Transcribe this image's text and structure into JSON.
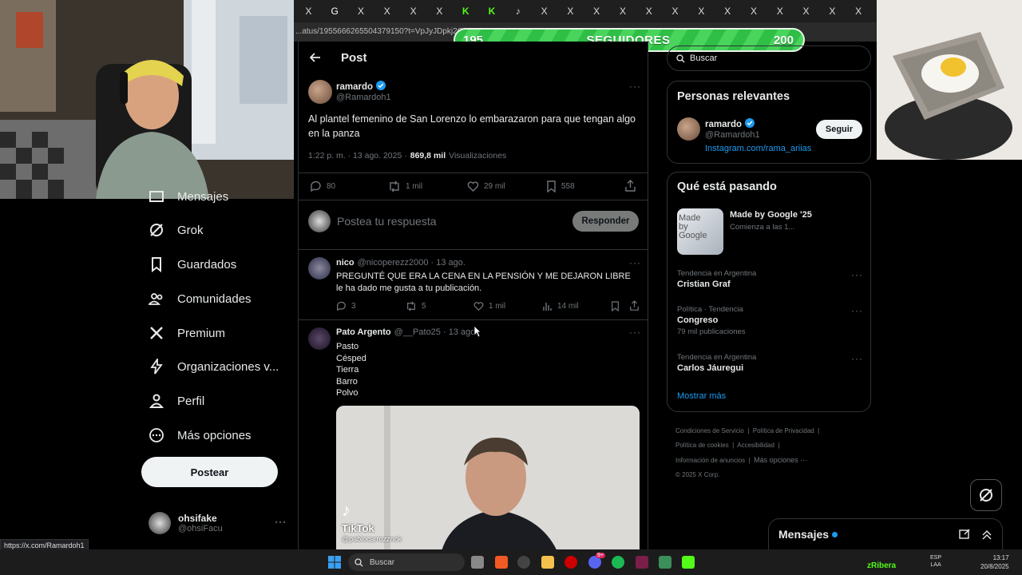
{
  "browser": {
    "tabs": [
      "X",
      "G",
      "X",
      "X",
      "X",
      "X",
      "K",
      "K",
      "♪",
      "X",
      "X",
      "X",
      "X",
      "X",
      "X",
      "X",
      "X",
      "X",
      "X",
      "X",
      "X",
      "X"
    ],
    "url": "...atus/1955666265504379150?t=VpJyJDpkj2CU8t-R"
  },
  "follower_bar": {
    "start": "195",
    "label": "SEGUIDORES",
    "goal": "200"
  },
  "nav": {
    "items": [
      {
        "label": "Mensajes",
        "icon": "mail-icon"
      },
      {
        "label": "Grok",
        "icon": "grok-icon"
      },
      {
        "label": "Guardados",
        "icon": "bookmark-icon"
      },
      {
        "label": "Comunidades",
        "icon": "communities-icon"
      },
      {
        "label": "Premium",
        "icon": "x-logo-icon"
      },
      {
        "label": "Organizaciones v...",
        "icon": "lightning-icon"
      },
      {
        "label": "Perfil",
        "icon": "person-icon"
      },
      {
        "label": "Más opciones",
        "icon": "more-circle-icon"
      }
    ],
    "post_button": "Postear",
    "account": {
      "name": "ohsifake",
      "handle": "@ohsiFacu"
    }
  },
  "post": {
    "header": "Post",
    "author": {
      "name": "ramardo",
      "handle": "@Ramardoh1"
    },
    "text": "Al plantel femenino de San Lorenzo lo embarazaron para que tengan algo en la panza",
    "time": "1:22 p. m. · 13 ago. 2025 ·",
    "views_count": "869,8 mil",
    "views_label": "Visualizaciones",
    "stats": {
      "replies": "80",
      "reposts": "1 mil",
      "likes": "29 mil",
      "bookmarks": "558"
    }
  },
  "reply_box": {
    "placeholder": "Postea tu respuesta",
    "button": "Responder"
  },
  "replies": [
    {
      "name": "nico",
      "handle": "@nicoperezz2000 · 13 ago.",
      "text": "PREGUNTÉ QUE ERA LA CENA EN LA PENSIÓN Y ME DEJARON LIBRE le ha dado me gusta a tu publicación.",
      "stats": {
        "replies": "3",
        "reposts": "5",
        "likes": "1 mil",
        "views": "14 mil"
      }
    },
    {
      "name": "Pato Argento",
      "handle": "@__Pato25 · 13 ago.",
      "lines": [
        "Pasto",
        "Césped",
        "Tierra",
        "Barro",
        "Polvo"
      ],
      "video": {
        "watermark": "TikTok",
        "user": "@pablocarrozznok"
      }
    }
  ],
  "sidebar": {
    "search_placeholder": "Buscar",
    "relevant": {
      "title": "Personas relevantes",
      "name": "ramardo",
      "handle": "@Ramardoh1",
      "link": "Instagram.com/rama_ariias",
      "follow": "Seguir"
    },
    "trends": {
      "title": "Qué está pasando",
      "promo": {
        "name": "Made by Google '25",
        "sub": "Comienza a las 1...",
        "thumb_text": "Made by Google"
      },
      "items": [
        {
          "meta": "Tendencia en Argentina",
          "name": "Cristian Graf",
          "count": ""
        },
        {
          "meta": "Política · Tendencia",
          "name": "Congreso",
          "count": "79 mil publicaciones"
        },
        {
          "meta": "Tendencia en Argentina",
          "name": "Carlos Jáuregui",
          "count": ""
        }
      ],
      "more": "Mostrar más"
    },
    "footer": [
      "Condiciones de Servicio",
      "Política de Privacidad",
      "Política de cookies",
      "Accesibilidad",
      "Información de anuncios",
      "Más opciones ···",
      "© 2025 X Corp."
    ]
  },
  "messages_dock": {
    "label": "Mensajes"
  },
  "status_url": "https://x.com/Ramardoh1",
  "taskbar": {
    "search": "Buscar",
    "tray_user": "zRibera",
    "lang": "ESP",
    "lang2": "LAA",
    "time": "13:17",
    "date": "20/8/2025",
    "discord_badge": "9+"
  },
  "colors": {
    "accent": "#1d9bf0",
    "follow_green": "#2fbe46",
    "kick_green": "#53fc18"
  }
}
